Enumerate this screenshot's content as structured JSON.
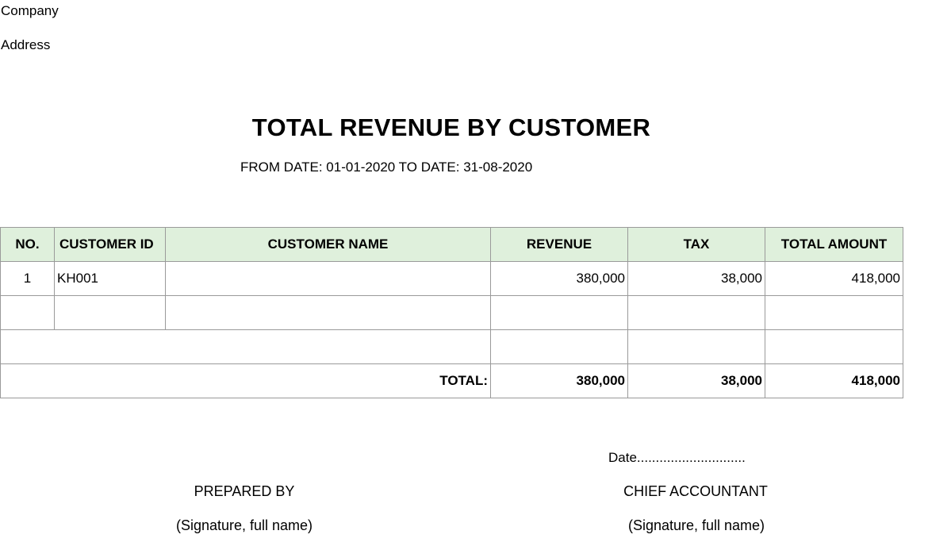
{
  "header": {
    "company": "Company",
    "address": "Address"
  },
  "report": {
    "title": "TOTAL REVENUE BY CUSTOMER",
    "date_range": "FROM DATE: 01-01-2020 TO DATE: 31-08-2020"
  },
  "table": {
    "columns": [
      "NO.",
      "CUSTOMER ID",
      "CUSTOMER NAME",
      "REVENUE",
      "TAX",
      "TOTAL AMOUNT"
    ],
    "header_color": "#dff0dc",
    "rows": [
      {
        "no": "1",
        "customer_id": "KH001",
        "customer_name": "",
        "revenue": "380,000",
        "tax": "38,000",
        "total_amount": "418,000"
      },
      {
        "no": "",
        "customer_id": "",
        "customer_name": "",
        "revenue": "",
        "tax": "",
        "total_amount": ""
      }
    ],
    "total": {
      "label": "TOTAL:",
      "revenue": "380,000",
      "tax": "38,000",
      "total_amount": "418,000"
    }
  },
  "footer": {
    "date_line": "Date.............................",
    "prepared_by": "PREPARED BY",
    "prepared_signature": "(Signature, full name)",
    "chief_accountant": "CHIEF ACCOUNTANT",
    "chief_signature": "(Signature, full name)"
  }
}
